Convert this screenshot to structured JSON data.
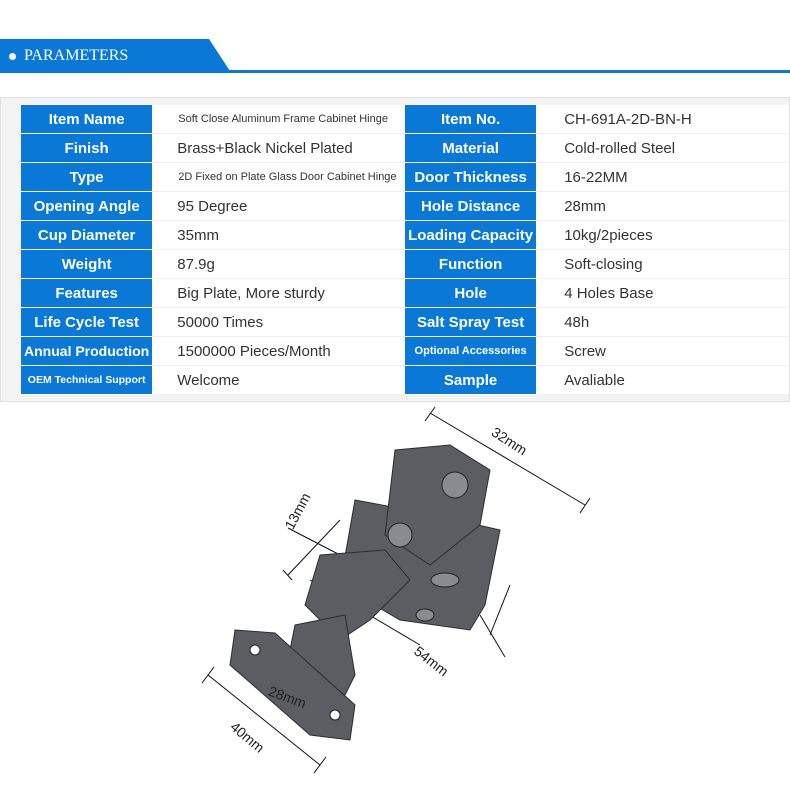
{
  "section": {
    "title": "PARAMETERS"
  },
  "rows": [
    {
      "l1": "Item Name",
      "v1": "Soft Close Aluminum Frame Cabinet Hinge",
      "l2": "Item No.",
      "v2": "CH-691A-2D-BN-H"
    },
    {
      "l1": "Finish",
      "v1": "Brass+Black Nickel Plated",
      "l2": "Material",
      "v2": "Cold-rolled Steel"
    },
    {
      "l1": "Type",
      "v1": "2D Fixed on Plate Glass Door Cabinet Hinge",
      "l2": "Door Thickness",
      "v2": "16-22MM"
    },
    {
      "l1": "Opening Angle",
      "v1": "95 Degree",
      "l2": "Hole Distance",
      "v2": "28mm"
    },
    {
      "l1": "Cup Diameter",
      "v1": "35mm",
      "l2": "Loading Capacity",
      "v2": "10kg/2pieces"
    },
    {
      "l1": "Weight",
      "v1": "87.9g",
      "l2": "Function",
      "v2": "Soft-closing"
    },
    {
      "l1": "Features",
      "v1": "Big Plate, More sturdy",
      "l2": "Hole",
      "v2": "4 Holes Base"
    },
    {
      "l1": "Life Cycle Test",
      "v1": "50000 Times",
      "l2": "Salt Spray Test",
      "v2": "48h"
    },
    {
      "l1": "Annual Production",
      "v1": "1500000 Pieces/Month",
      "l2": "Optional Accessories",
      "v2": "Screw"
    },
    {
      "l1": "OEM Technical Support",
      "v1": "Welcome",
      "l2": "Sample",
      "v2": "Avaliable"
    }
  ],
  "dimensions": {
    "d1": "32mm",
    "d2": "13mm",
    "d3": "54mm",
    "d4": "28mm",
    "d5": "40mm"
  },
  "colors": {
    "accent": "#0a78d7"
  }
}
